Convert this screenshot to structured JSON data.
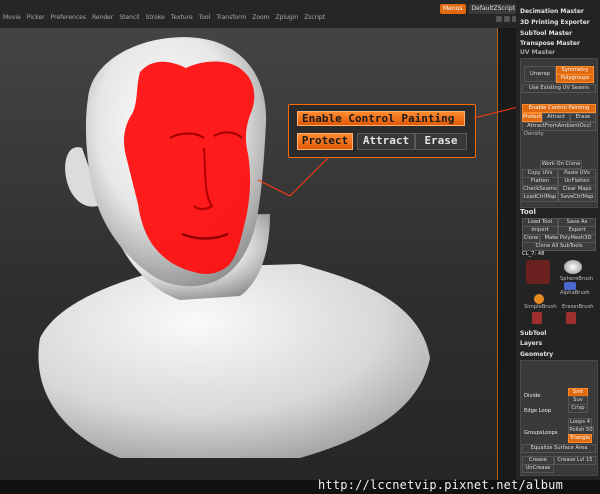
{
  "menu": [
    "Movie",
    "Picker",
    "Preferences",
    "Render",
    "Stencil",
    "Stroke",
    "Texture",
    "Tool",
    "Transform",
    "Zoom",
    "Zplugin",
    "Zscript"
  ],
  "top_right": {
    "menus_label": "Menus",
    "script_label": "DefaultZScript"
  },
  "callout": {
    "enable_label": "Enable Control Painting",
    "protect_label": "Protect",
    "attract_label": "Attract",
    "erase_label": "Erase"
  },
  "right_panel": {
    "sections": {
      "decimation": "Decimation Master",
      "printing": "3D Printing Exporter",
      "subtool_master": "SubTool Master",
      "transpose_master": "Transpose Master",
      "uv_master": "UV Master"
    },
    "uv": {
      "unwrap": "Unwrap",
      "symmetry": "Symmetry",
      "polygroups": "Polygroups",
      "use_existing": "Use Existing UV Seams",
      "enable_cp": "Enable Control Painting",
      "protect": "Protect",
      "attract": "Attract",
      "erase": "Erase",
      "attract_ambient": "AttractFromAmbientOccl",
      "density": "Density",
      "work_on_clone": "Work On Clone",
      "copy_uvs": "Copy UVs",
      "paste_uvs": "Paste UVs",
      "flatten": "Flatten",
      "unflatten": "UnFlatten",
      "checkseams": "CheckSeams",
      "clear_maps": "Clear Maps",
      "load_ctrl": "LoadCtrlMap",
      "save_ctrl": "SaveCtrlMap"
    },
    "tool": {
      "title": "Tool",
      "load_tool": "Load Tool",
      "save_as": "Save As",
      "import": "Import",
      "export": "Export",
      "clone": "Clone",
      "make_polymesh": "Make PolyMesh3D",
      "clone_all": "Clone All SubTools",
      "current": "CL_7: 48",
      "sphere": "SphereBrush",
      "alpha": "AlphaBrush",
      "simple": "SimpleBrush",
      "eraser": "EraserBrush"
    },
    "subtool": "SubTool",
    "layers": "Layers",
    "geometry": "Geometry",
    "geo": {
      "divide": "Divide",
      "smt": "Smt",
      "suv": "Suv",
      "edge_loop": "Edge Loop",
      "crisp": "Crisp",
      "groups_loops": "GroupsLoops",
      "loops": "Loops 4",
      "polish": "Polish 50",
      "triangle": "Triangle",
      "equalize": "Equalize Surface Area",
      "crease": "Crease",
      "crease_lvl": "Crease Lvl 15",
      "uncrease": "UnCrease"
    }
  },
  "watermark": "http://lccnetvip.pixnet.net/album",
  "colors": {
    "accent": "#e06a10",
    "paint": "#ff1010",
    "panel": "#232323"
  }
}
